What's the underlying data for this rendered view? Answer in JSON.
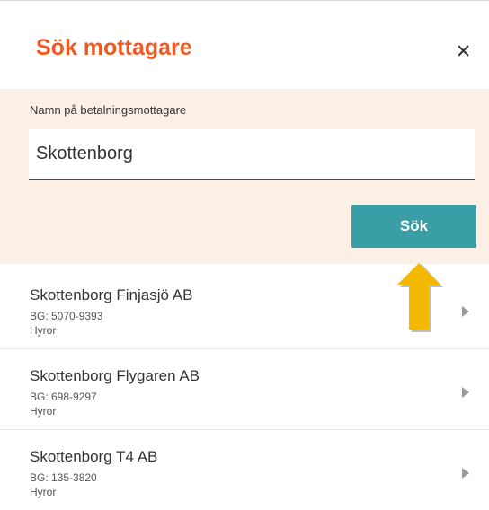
{
  "dialog": {
    "title": "Sök mottagare",
    "close_icon": "close-icon"
  },
  "search": {
    "label": "Namn på betalningsmottagare",
    "value": "Skottenborg",
    "button_label": "Sök"
  },
  "results": [
    {
      "name": "Skottenborg Finjasjö AB",
      "bg": "BG: 5070-9393",
      "category": "Hyror"
    },
    {
      "name": "Skottenborg Flygaren AB",
      "bg": "BG: 698-9297",
      "category": "Hyror"
    },
    {
      "name": "Skottenborg T4 AB",
      "bg": "BG: 135-3820",
      "category": "Hyror"
    }
  ],
  "colors": {
    "accent": "#ec5b24",
    "button": "#3a9ea6",
    "panel": "#fcf0e6",
    "arrow": "#f5b800"
  }
}
